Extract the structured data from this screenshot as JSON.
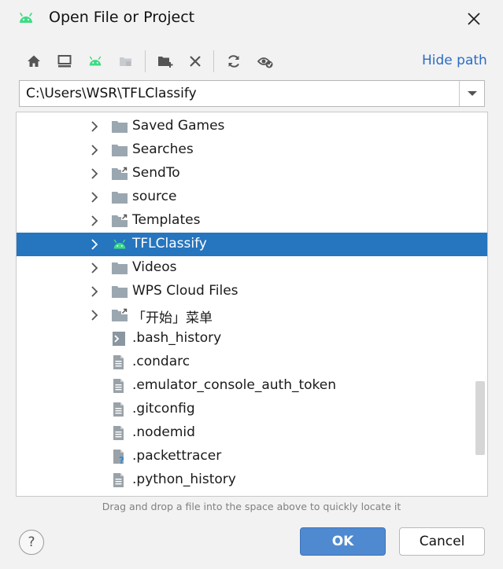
{
  "window": {
    "title": "Open File or Project",
    "title_icon": "android-icon",
    "close_icon": "close-icon"
  },
  "toolbar": {
    "buttons": [
      {
        "name": "home-directory-button",
        "icon": "home-icon"
      },
      {
        "name": "desktop-button",
        "icon": "desktop-icon"
      },
      {
        "name": "project-directory-button",
        "icon": "android-icon"
      },
      {
        "name": "module-directory-button",
        "icon": "module-folder-icon"
      },
      {
        "name": "new-folder-button",
        "icon": "new-folder-icon"
      },
      {
        "name": "delete-button",
        "icon": "delete-icon"
      },
      {
        "name": "refresh-button",
        "icon": "refresh-icon"
      },
      {
        "name": "show-hidden-button",
        "icon": "show-hidden-icon"
      }
    ],
    "hide_path_label": "Hide path"
  },
  "path": {
    "value": "C:\\Users\\WSR\\TFLClassify"
  },
  "tree": {
    "items": [
      {
        "label": "Saved Games",
        "icon": "folder-icon",
        "expandable": true,
        "selected": false
      },
      {
        "label": "Searches",
        "icon": "folder-icon",
        "expandable": true,
        "selected": false
      },
      {
        "label": "SendTo",
        "icon": "folder-shortcut-icon",
        "expandable": true,
        "selected": false
      },
      {
        "label": "source",
        "icon": "folder-icon",
        "expandable": true,
        "selected": false
      },
      {
        "label": "Templates",
        "icon": "folder-shortcut-icon",
        "expandable": true,
        "selected": false
      },
      {
        "label": "TFLClassify",
        "icon": "android-icon",
        "expandable": true,
        "selected": true
      },
      {
        "label": "Videos",
        "icon": "folder-icon",
        "expandable": true,
        "selected": false
      },
      {
        "label": "WPS Cloud Files",
        "icon": "folder-icon",
        "expandable": true,
        "selected": false
      },
      {
        "label": "「开始」菜单",
        "icon": "folder-shortcut-icon",
        "expandable": true,
        "selected": false
      },
      {
        "label": ".bash_history",
        "icon": "shell-file-icon",
        "expandable": false,
        "selected": false
      },
      {
        "label": ".condarc",
        "icon": "text-file-icon",
        "expandable": false,
        "selected": false
      },
      {
        "label": ".emulator_console_auth_token",
        "icon": "text-file-icon",
        "expandable": false,
        "selected": false
      },
      {
        "label": ".gitconfig",
        "icon": "text-file-icon",
        "expandable": false,
        "selected": false
      },
      {
        "label": ".nodemid",
        "icon": "text-file-icon",
        "expandable": false,
        "selected": false
      },
      {
        "label": ".packettracer",
        "icon": "unknown-file-icon",
        "expandable": false,
        "selected": false
      },
      {
        "label": ".python_history",
        "icon": "text-file-icon",
        "expandable": false,
        "selected": false
      }
    ]
  },
  "hint": "Drag and drop a file into the space above to quickly locate it",
  "footer": {
    "help_label": "?",
    "ok_label": "OK",
    "cancel_label": "Cancel"
  },
  "colors": {
    "accent": "#2675bf",
    "link": "#2b6cc4",
    "android_green": "#3ddc84",
    "folder": "#9aa7b0",
    "ok_button": "#4f8ad0"
  }
}
